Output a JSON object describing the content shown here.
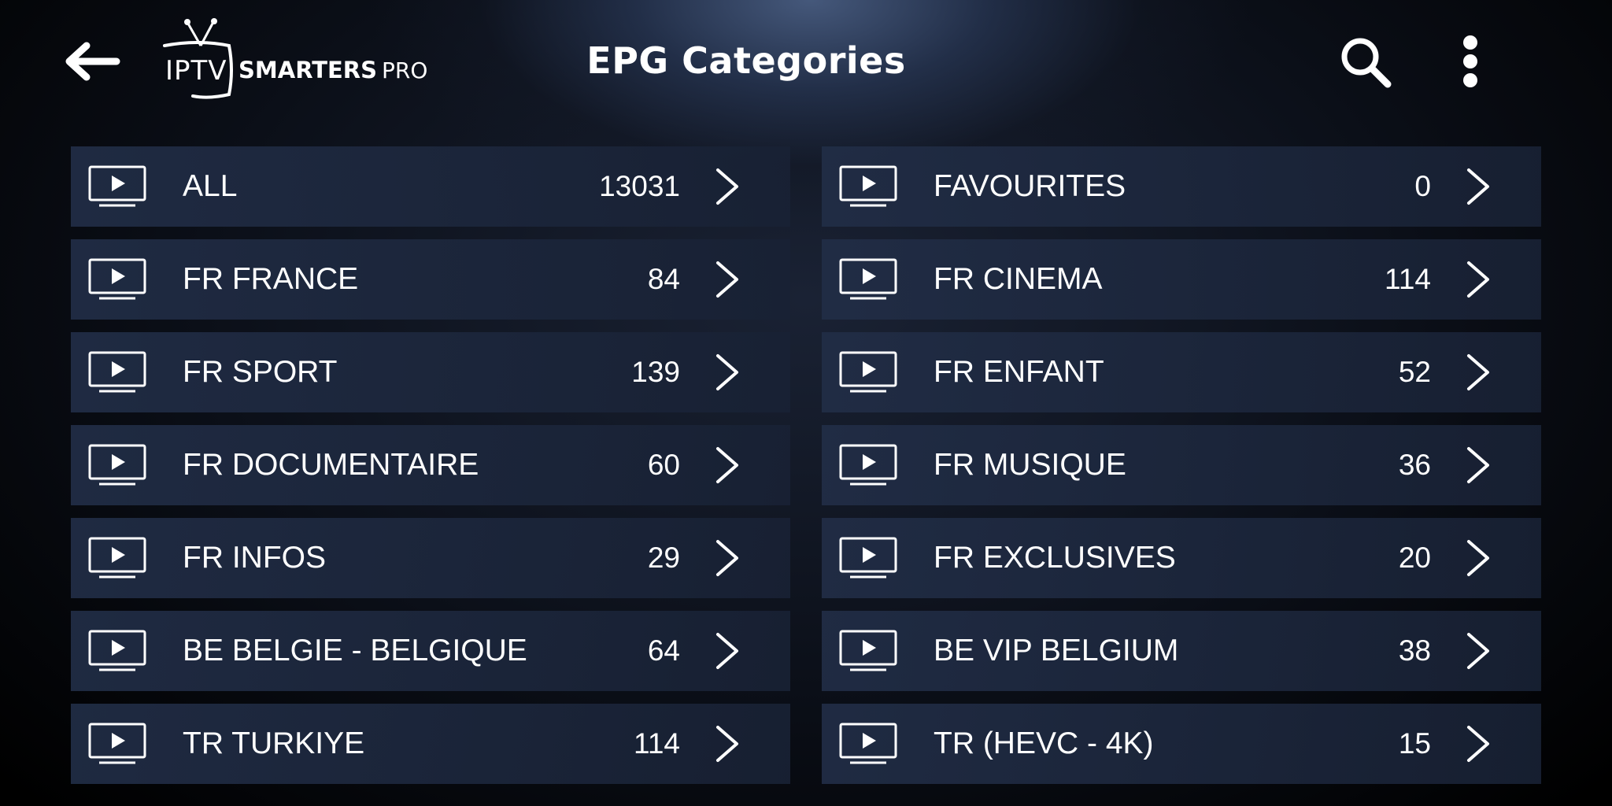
{
  "header": {
    "back_icon": "arrow-left-icon",
    "logo": {
      "iptv": "IPTV",
      "smarters": "SMARTERS",
      "pro": "PRO"
    },
    "title": "EPG Categories",
    "search_icon": "search-icon",
    "menu_icon": "more-vertical-icon"
  },
  "categories": [
    {
      "label": "ALL",
      "count": "13031"
    },
    {
      "label": "FAVOURITES",
      "count": "0"
    },
    {
      "label": "FR FRANCE",
      "count": "84"
    },
    {
      "label": "FR CINEMA",
      "count": "114"
    },
    {
      "label": "FR SPORT",
      "count": "139"
    },
    {
      "label": "FR ENFANT",
      "count": "52"
    },
    {
      "label": "FR DOCUMENTAIRE",
      "count": "60"
    },
    {
      "label": "FR MUSIQUE",
      "count": "36"
    },
    {
      "label": "FR INFOS",
      "count": "29"
    },
    {
      "label": "FR EXCLUSIVES",
      "count": "20"
    },
    {
      "label": "BE BELGIE - BELGIQUE",
      "count": "64"
    },
    {
      "label": "BE VIP BELGIUM",
      "count": "38"
    },
    {
      "label": "TR TURKIYE",
      "count": "114"
    },
    {
      "label": "TR (HEVC - 4K)",
      "count": "15"
    }
  ],
  "row_icons": {
    "category": "tv-play-icon",
    "open": "chevron-right-icon"
  },
  "colors": {
    "row_background": "#1f2b43",
    "text": "#ffffff"
  }
}
